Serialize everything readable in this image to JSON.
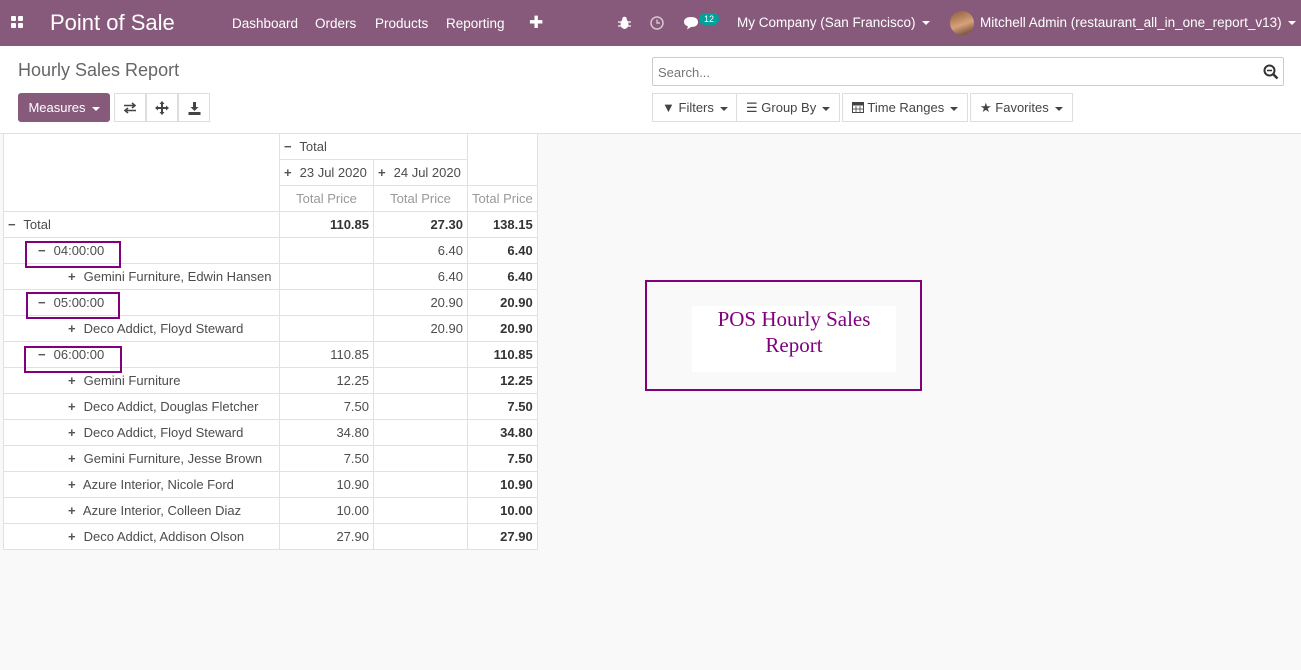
{
  "navbar": {
    "brand": "Point of Sale",
    "menu": [
      "Dashboard",
      "Orders",
      "Products",
      "Reporting"
    ],
    "message_count": "12",
    "company": "My Company (San Francisco)",
    "user": "Mitchell Admin (restaurant_all_in_one_report_v13)"
  },
  "control_panel": {
    "title": "Hourly Sales Report",
    "measures_label": "Measures",
    "search_placeholder": "Search...",
    "filters_label": "Filters",
    "groupby_label": "Group By",
    "timeranges_label": "Time Ranges",
    "favorites_label": "Favorites"
  },
  "pivot": {
    "col_total": "Total",
    "col_dates": [
      "23 Jul 2020",
      "24 Jul 2020"
    ],
    "measure": "Total Price",
    "rows": [
      {
        "label": "Total",
        "v1": "110.85",
        "v2": "27.30",
        "total": "138.15"
      },
      {
        "label": "04:00:00",
        "v1": "",
        "v2": "6.40",
        "total": "6.40"
      },
      {
        "label": "Gemini Furniture, Edwin Hansen",
        "v1": "",
        "v2": "6.40",
        "total": "6.40"
      },
      {
        "label": "05:00:00",
        "v1": "",
        "v2": "20.90",
        "total": "20.90"
      },
      {
        "label": "Deco Addict, Floyd Steward",
        "v1": "",
        "v2": "20.90",
        "total": "20.90"
      },
      {
        "label": "06:00:00",
        "v1": "110.85",
        "v2": "",
        "total": "110.85"
      },
      {
        "label": "Gemini Furniture",
        "v1": "12.25",
        "v2": "",
        "total": "12.25"
      },
      {
        "label": "Deco Addict, Douglas Fletcher",
        "v1": "7.50",
        "v2": "",
        "total": "7.50"
      },
      {
        "label": "Deco Addict, Floyd Steward",
        "v1": "34.80",
        "v2": "",
        "total": "34.80"
      },
      {
        "label": "Gemini Furniture, Jesse Brown",
        "v1": "7.50",
        "v2": "",
        "total": "7.50"
      },
      {
        "label": "Azure Interior, Nicole Ford",
        "v1": "10.90",
        "v2": "",
        "total": "10.90"
      },
      {
        "label": "Azure Interior, Colleen Diaz",
        "v1": "10.00",
        "v2": "",
        "total": "10.00"
      },
      {
        "label": "Deco Addict, Addison Olson",
        "v1": "27.90",
        "v2": "",
        "total": "27.90"
      }
    ]
  },
  "callout": {
    "line1": "POS Hourly Sales",
    "line2": "Report"
  },
  "colors": {
    "navbar": "#875a7b",
    "highlight": "#800080",
    "badge": "#00a09d"
  }
}
